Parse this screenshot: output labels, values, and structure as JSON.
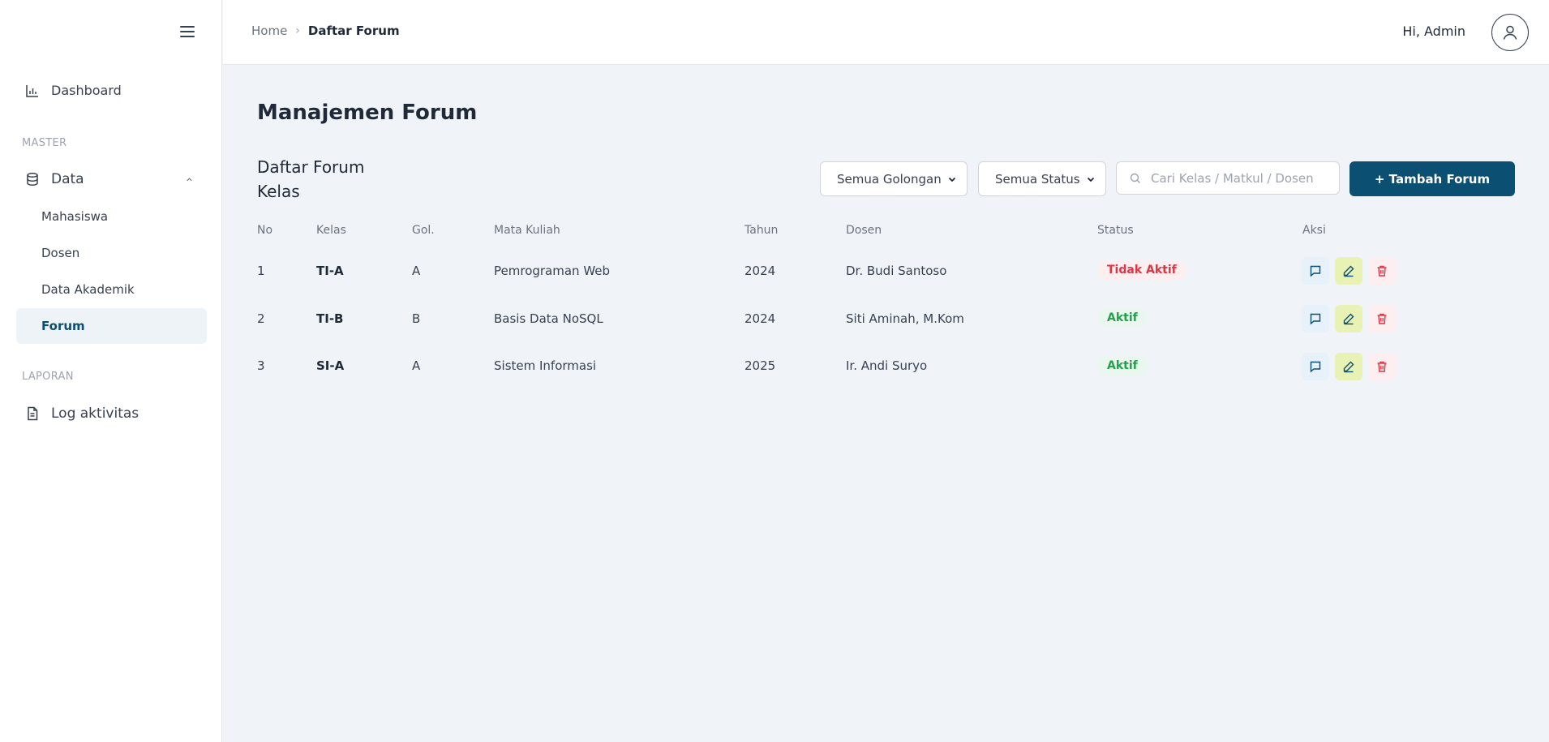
{
  "sidebar": {
    "dashboard": "Dashboard",
    "section_master": "MASTER",
    "data": "Data",
    "sub_items": [
      "Mahasiswa",
      "Dosen",
      "Data Akademik",
      "Forum"
    ],
    "section_laporan": "LAPORAN",
    "log": "Log aktivitas"
  },
  "header": {
    "breadcrumb_home": "Home",
    "breadcrumb_current": "Daftar Forum",
    "greeting": "Hi, Admin"
  },
  "main": {
    "title": "Manajemen Forum",
    "card_title": "Daftar Forum Kelas",
    "filter_golongan": "Semua Golongan",
    "filter_status": "Semua Status",
    "search_placeholder": "Cari Kelas / Matkul / Dosen",
    "add_button": "+ Tambah Forum"
  },
  "table": {
    "headers": [
      "No",
      "Kelas",
      "Gol.",
      "Mata Kuliah",
      "Tahun",
      "Dosen",
      "Status",
      "Aksi"
    ],
    "rows": [
      {
        "no": "1",
        "kelas": "TI-A",
        "gol": "A",
        "matkul": "Pemrograman Web",
        "tahun": "2024",
        "dosen": "Dr. Budi Santoso",
        "status": "Tidak Aktif"
      },
      {
        "no": "2",
        "kelas": "TI-B",
        "gol": "B",
        "matkul": "Basis Data NoSQL",
        "tahun": "2024",
        "dosen": "Siti Aminah, M.Kom",
        "status": "Aktif"
      },
      {
        "no": "3",
        "kelas": "SI-A",
        "gol": "A",
        "matkul": "Sistem Informasi",
        "tahun": "2025",
        "dosen": "Ir. Andi Suryo",
        "status": "Aktif"
      }
    ]
  },
  "colors": {
    "primary": "#0b4f72",
    "inactive": "#dc3545",
    "active": "#22a04b",
    "background": "#f0f4f8"
  }
}
